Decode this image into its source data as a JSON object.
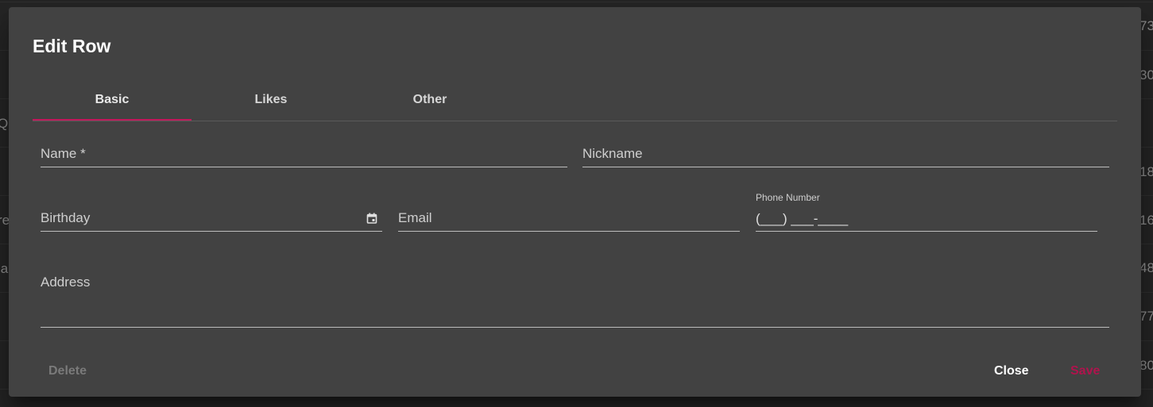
{
  "background": {
    "right_values": [
      "73",
      "30",
      "18",
      "16",
      "48",
      "77",
      "80"
    ],
    "left_fragments": [
      "Q",
      "re",
      "la"
    ]
  },
  "dialog": {
    "title": "Edit Row",
    "tabs": [
      {
        "label": "Basic",
        "active": true
      },
      {
        "label": "Likes",
        "active": false
      },
      {
        "label": "Other",
        "active": false
      }
    ],
    "fields": {
      "name": {
        "label": "Name *",
        "value": ""
      },
      "nickname": {
        "label": "Nickname",
        "value": ""
      },
      "birthday": {
        "label": "Birthday",
        "value": "",
        "icon": "calendar-icon"
      },
      "email": {
        "label": "Email",
        "value": ""
      },
      "phone": {
        "label": "Phone Number",
        "value": "(___) ___-____"
      },
      "address": {
        "label": "Address",
        "value": ""
      }
    },
    "actions": {
      "delete": "Delete",
      "close": "Close",
      "save": "Save"
    }
  },
  "colors": {
    "dialog_bg": "#424242",
    "accent": "#c2185b",
    "save_text": "#b0134d"
  }
}
